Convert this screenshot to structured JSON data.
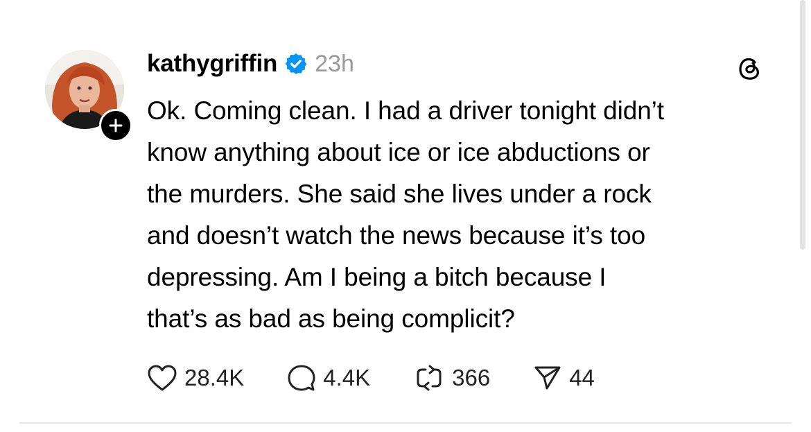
{
  "post": {
    "username": "kathygriffin",
    "timestamp": "23h",
    "verified": true,
    "body_lines": [
      "Ok. Coming clean. I had a driver tonight didn’t",
      "know anything about ice or ice abductions or",
      "the murders. She said she lives under a rock",
      "and doesn’t watch the news because it’s too",
      "depressing. Am I being a bitch because I",
      "that’s as bad as being complicit?"
    ],
    "actions": {
      "likes": "28.4K",
      "comments": "4.4K",
      "reposts": "366",
      "shares": "44"
    }
  },
  "icons": {
    "avatar": "profile-photo",
    "follow": "plus-icon",
    "verified": "verified-badge-icon",
    "app": "threads-logo-icon",
    "like": "heart-icon",
    "comment": "comment-bubble-icon",
    "repost": "repost-icon",
    "share": "send-icon"
  },
  "colors": {
    "verified_blue": "#0095f6",
    "timestamp_gray": "#999999"
  }
}
